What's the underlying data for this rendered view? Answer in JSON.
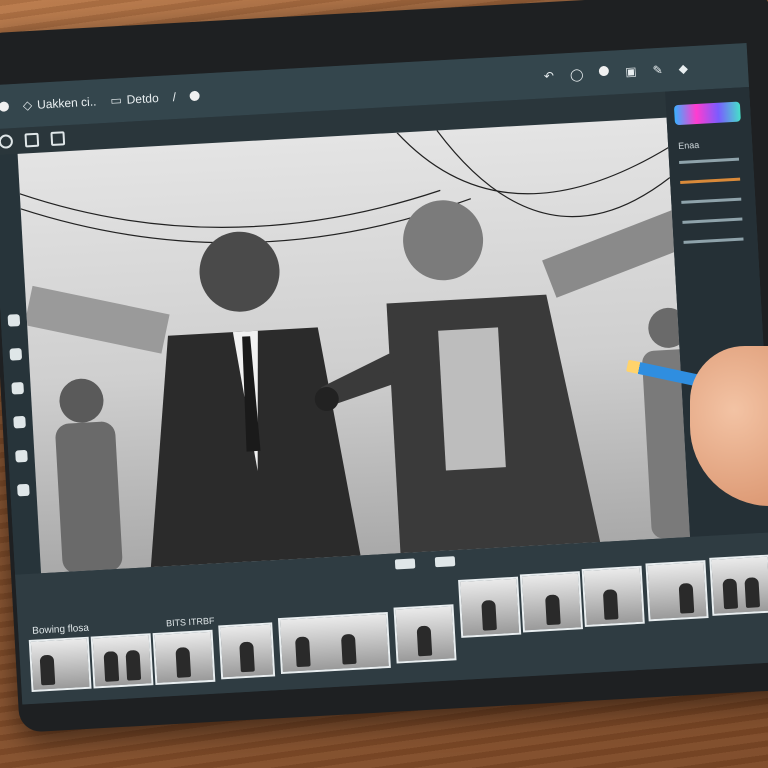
{
  "toolbar": {
    "items": [
      {
        "icon": "arrow-icon",
        "label": "Uakken ci.."
      },
      {
        "icon": "folder-icon",
        "label": "Detdo"
      }
    ]
  },
  "right_panel": {
    "label": "Enaa"
  },
  "filmstrip": {
    "label": "Bowing flosa",
    "tag": "BITS ITRBF"
  },
  "colors": {
    "ui_dark": "#2c3a40",
    "ui_bar": "#34464d",
    "accent_cyan": "#3ab0ff",
    "accent_magenta": "#ff3ccf"
  }
}
